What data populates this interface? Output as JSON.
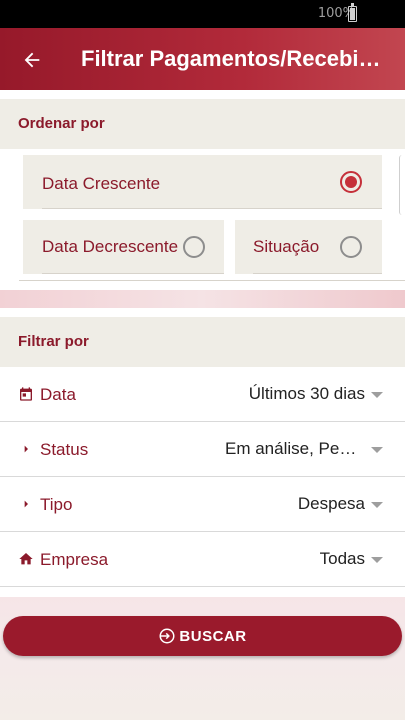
{
  "status_bar": {
    "battery": "100%"
  },
  "app_bar": {
    "title": "Filtrar Pagamentos/Recebimentos"
  },
  "order_section": {
    "title": "Ordenar por",
    "options": [
      {
        "label": "Data Crescente",
        "selected": true
      },
      {
        "label": "Data Decrescente",
        "selected": false
      },
      {
        "label": "Situação",
        "selected": false
      }
    ]
  },
  "filter_section": {
    "title": "Filtrar por",
    "rows": [
      {
        "icon": "calendar-icon",
        "label": "Data",
        "value": "Últimos 30 dias"
      },
      {
        "icon": "arrow-right-icon",
        "label": "Status",
        "value": "Em análise, Pendente"
      },
      {
        "icon": "arrow-right-icon",
        "label": "Tipo",
        "value": "Despesa"
      },
      {
        "icon": "home-icon",
        "label": "Empresa",
        "value": "Todas"
      }
    ]
  },
  "search_button": {
    "label": "BUSCAR",
    "icon": "login-icon"
  },
  "colors": {
    "primary": "#96192a",
    "accent": "#c5303a",
    "section_bg": "#efede6"
  }
}
